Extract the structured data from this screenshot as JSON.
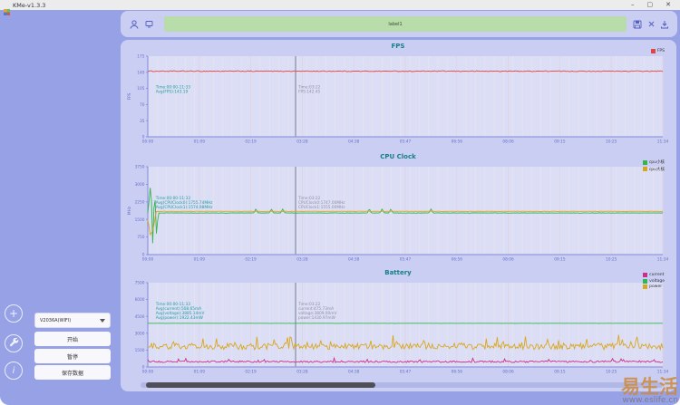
{
  "window": {
    "title": "KMe-v1.3.3",
    "minimize": "–",
    "maximize": "▢",
    "close": "✕"
  },
  "topbar": {
    "field_value": "label1"
  },
  "sidebar": {
    "device_select": "V2036A(WIFI)",
    "start_label": "开始",
    "pause_label": "暂停",
    "save_label": "保存数据"
  },
  "watermark": {
    "brand": "易生活",
    "url": "www.eslife.cn"
  },
  "colors": {
    "background": "#97a1e6",
    "card": "#c9cef2",
    "plot_bg": "#dcdef5",
    "input_green": "#b9dcab",
    "title_teal": "#15808a",
    "annotation_teal": "#1f9e9e",
    "fps_red": "#e24444",
    "cpu_green": "#34b44a",
    "cpu_orange": "#d9a71e",
    "current_magenta": "#cc2f8a",
    "voltage_green": "#2eb84f",
    "power_gold": "#d9a71e"
  },
  "chart_data": [
    {
      "type": "line",
      "title": "FPS",
      "ylabel": "FPS",
      "ylim": [
        0,
        175
      ],
      "yticks": [
        0,
        35,
        70,
        105,
        140,
        175
      ],
      "x_ticks": [
        "00:00",
        "01:09",
        "02:19",
        "03:28",
        "04:38",
        "05:47",
        "06:56",
        "08:06",
        "09:15",
        "10:25",
        "11:34"
      ],
      "grid": true,
      "legend_position": "right",
      "series": [
        {
          "name": "FPS",
          "color": "#e24444",
          "base": 142.4,
          "noise": 0.9
        }
      ],
      "avg_annotation": {
        "x_frac": 0.01,
        "y_frac": 0.4,
        "lines": [
          "Time:00:00-11:33",
          "Avg(FPS):143.19"
        ]
      },
      "cursor": {
        "x_frac": 0.287,
        "lines": [
          "Time:03:22",
          "FPS:142.45"
        ]
      }
    },
    {
      "type": "line",
      "title": "CPU Clock",
      "ylabel": "MHz",
      "ylim": [
        0,
        3750
      ],
      "yticks": [
        0,
        750,
        1500,
        2250,
        3000,
        3750
      ],
      "x_ticks": [
        "00:00",
        "01:09",
        "02:19",
        "03:28",
        "04:38",
        "05:47",
        "06:56",
        "08:06",
        "09:15",
        "10:25",
        "11:34"
      ],
      "grid": true,
      "legend_position": "right",
      "series": [
        {
          "name": "cpu小核",
          "color": "#34b44a",
          "noise": 7,
          "segments": [
            [
              0,
              1775
            ],
            [
              0.006,
              3120
            ],
            [
              0.01,
              130
            ],
            [
              0.013,
              3080
            ],
            [
              0.017,
              700
            ],
            [
              0.02,
              1775
            ],
            [
              1,
              1775
            ]
          ],
          "spikes": [
            [
              0.21,
              1955
            ],
            [
              0.24,
              1950
            ],
            [
              0.262,
              1945
            ],
            [
              0.43,
              1960
            ],
            [
              0.455,
              1950
            ],
            [
              0.472,
              1955
            ],
            [
              0.55,
              1945
            ]
          ]
        },
        {
          "name": "cpu大核",
          "color": "#d9a71e",
          "noise": 5,
          "segments": [
            [
              0,
              1500
            ],
            [
              0.005,
              820
            ],
            [
              0.011,
              1120
            ],
            [
              0.016,
              1845
            ],
            [
              1,
              1845
            ]
          ]
        }
      ],
      "avg_annotation": {
        "x_frac": 0.01,
        "y_frac": 0.37,
        "lines": [
          "Time:00:00-11:33",
          "Avg(CPUClock0):1755.74MHz",
          "Avg(CPUClock1):1574.98MHz"
        ]
      },
      "cursor": {
        "x_frac": 0.287,
        "lines": [
          "Time:03:22",
          "CPUClock0:1747.00MHz",
          "CPUClock1:1555.00MHz"
        ]
      }
    },
    {
      "type": "line",
      "title": "Battery",
      "ylabel": "",
      "ylim": [
        0,
        7500
      ],
      "yticks": [
        0,
        1500,
        3000,
        4500,
        6000,
        7500
      ],
      "x_ticks": [
        "00:00",
        "01:09",
        "02:19",
        "03:28",
        "04:38",
        "05:47",
        "06:56",
        "08:06",
        "09:15",
        "10:25",
        "11:34"
      ],
      "grid": true,
      "legend_position": "right",
      "series": [
        {
          "name": "current",
          "color": "#cc2f8a",
          "base": 470,
          "noise": 75,
          "spike_prob": 0.07,
          "spike_amp": 320
        },
        {
          "name": "voltage",
          "color": "#2eb84f",
          "base": 3885,
          "noise": 3
        },
        {
          "name": "power",
          "color": "#d9a71e",
          "base": 1830,
          "noise": 280,
          "spike_prob": 0.1,
          "spike_amp": 780
        }
      ],
      "avg_annotation": {
        "x_frac": 0.01,
        "y_frac": 0.27,
        "lines": [
          "Time:00:00-11:33",
          "Avg(current):508.65mA",
          "Avg(voltage):3885.14mV",
          "Avg(power):1922.43mW"
        ]
      },
      "cursor": {
        "x_frac": 0.287,
        "lines": [
          "Time:03:22",
          "current:475.73mA",
          "voltage:3809.00mV",
          "power:1430.97mW"
        ]
      }
    }
  ]
}
